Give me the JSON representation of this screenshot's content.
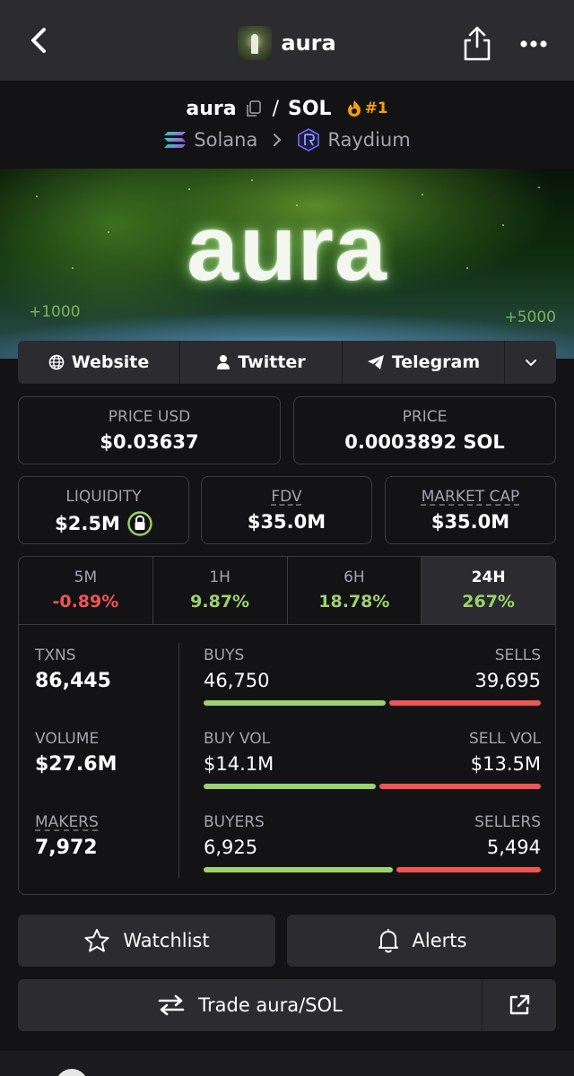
{
  "topbar": {
    "title": "aura",
    "back_icon": "chevron-left-icon",
    "share_icon": "share-icon",
    "more_icon": "more-dots-icon"
  },
  "pair": {
    "base": "aura",
    "separator": "/",
    "quote": "SOL",
    "rank": "#1"
  },
  "chain": {
    "network": "Solana",
    "dex": "Raydium"
  },
  "banner": {
    "word": "aura",
    "tag_left": "+1000",
    "tag_right": "+5000"
  },
  "links": {
    "website": "Website",
    "twitter": "Twitter",
    "telegram": "Telegram"
  },
  "price": {
    "usd_label": "PRICE USD",
    "usd_value": "$0.03637",
    "native_label": "PRICE",
    "native_value": "0.0003892 SOL"
  },
  "metrics": {
    "liquidity_label": "LIQUIDITY",
    "liquidity_value": "$2.5M",
    "fdv_label": "FDV",
    "fdv_value": "$35.0M",
    "mcap_label": "MARKET CAP",
    "mcap_value": "$35.0M"
  },
  "timeframes": [
    {
      "label": "5M",
      "change": "-0.89%"
    },
    {
      "label": "1H",
      "change": "9.87%"
    },
    {
      "label": "6H",
      "change": "18.78%"
    },
    {
      "label": "24H",
      "change": "267%"
    }
  ],
  "stats": {
    "txns_label": "TXNS",
    "txns_value": "86,445",
    "volume_label": "VOLUME",
    "volume_value": "$27.6M",
    "makers_label": "MAKERS",
    "makers_value": "7,972",
    "buys_label": "BUYS",
    "buys_value": "46,750",
    "sells_label": "SELLS",
    "sells_value": "39,695",
    "buy_vol_label": "BUY VOL",
    "buy_vol_value": "$14.1M",
    "sell_vol_label": "SELL VOL",
    "sell_vol_value": "$13.5M",
    "buyers_label": "BUYERS",
    "buyers_value": "6,925",
    "sellers_label": "SELLERS",
    "sellers_value": "5,494",
    "buys_share": 0.54,
    "buy_vol_share": 0.51,
    "buyers_share": 0.56
  },
  "actions": {
    "watchlist": "Watchlist",
    "alerts": "Alerts",
    "trade": "Trade aura/SOL"
  },
  "colors": {
    "positive": "#9bd36a",
    "negative": "#f05454",
    "panel": "#2b2b30",
    "rank": "#f59e0b"
  }
}
